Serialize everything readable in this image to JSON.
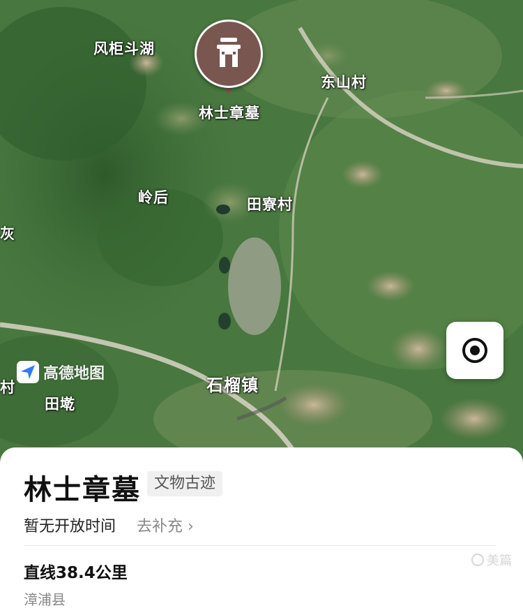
{
  "map": {
    "places": {
      "fengjudouhu": "风柜斗湖",
      "dongshancun": "东山村",
      "linghou": "岭后",
      "tianliaocun": "田寮村",
      "hui": "灰",
      "cun": "村",
      "tiandun": "田墘",
      "shiliuzhen": "石榴镇"
    },
    "poi_pin_label": "林士章墓",
    "poi_pin_icon": "pavilion-icon",
    "logo_text": "高德地图",
    "locate_icon": "locate-icon"
  },
  "card": {
    "title": "林士章墓",
    "category": "文物古迹",
    "hours": "暂无开放时间",
    "add_info": "去补充 ›",
    "distance": "直线38.4公里",
    "district": "漳浦县",
    "watermark": "美篇"
  },
  "colors": {
    "pin": "#7a5650",
    "logo_blue": "#2f7df6"
  }
}
